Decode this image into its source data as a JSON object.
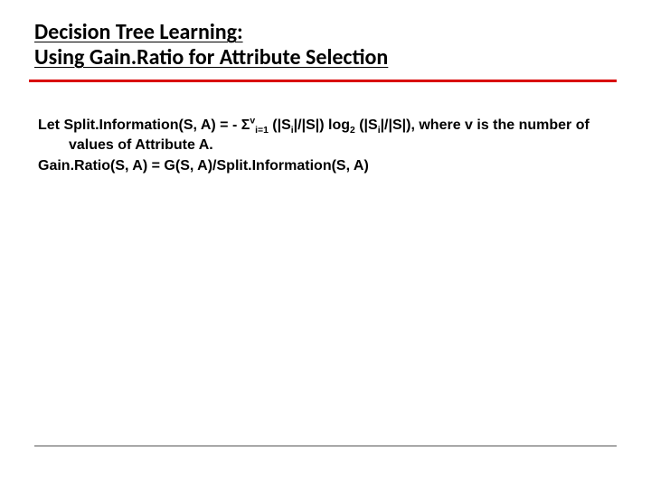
{
  "title": {
    "line1": "Decision Tree Learning:",
    "line2": "Using Gain.Ratio for Attribute Selection"
  },
  "body": {
    "def_prefix": "Let Split.Information(S, A) =  - ",
    "sigma": "Σ",
    "sup_v": "v",
    "sub_i1": "i=1",
    "ratio1_open": " (|S",
    "sub_i_a": "i",
    "ratio1_close": "|/|S|) log",
    "sub_2": "2",
    "ratio2_open": " (|S",
    "sub_i_b": "i",
    "ratio2_close": "|/|S|), where v is the number of values of Attribute A.",
    "gainratio": "Gain.Ratio(S, A) = G(S, A)/Split.Information(S, A)"
  }
}
